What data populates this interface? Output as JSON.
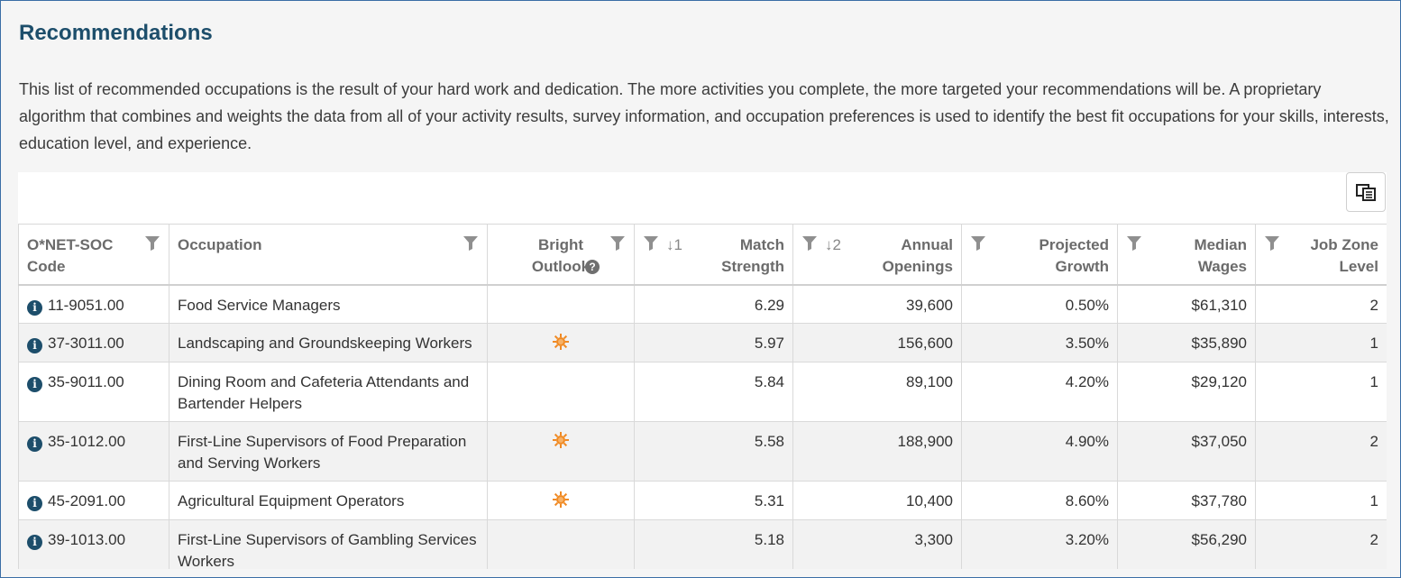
{
  "page": {
    "title": "Recommendations",
    "intro": "This list of recommended occupations is the result of your hard work and dedication. The more activities you complete, the more targeted your recommendations will be. A proprietary algorithm that combines and weights the data from all of your activity results, survey information, and occupation preferences is used to identify the best fit occupations for your skills, interests, education level, and experience."
  },
  "toolbar": {
    "column_chooser_icon": "column-chooser-icon"
  },
  "table": {
    "headers": {
      "code": "O*NET-SOC Code",
      "occupation": "Occupation",
      "bright_outlook": "Bright Outlook",
      "match_strength": "Match Strength",
      "annual_openings": "Annual Openings",
      "projected_growth": "Projected Growth",
      "median_wages": "Median Wages",
      "job_zone": "Job Zone Level"
    },
    "sort_indicators": {
      "match_strength": "↓1",
      "annual_openings": "↓2"
    },
    "icons": {
      "filter": "filter-icon",
      "info": "info-icon",
      "help": "help-icon",
      "bright_outlook": "sun-icon"
    },
    "colors": {
      "title": "#1d4e6b",
      "info_icon": "#1d4e6b",
      "sun": "#f08a24"
    },
    "rows": [
      {
        "code": "11-9051.00",
        "occupation": "Food Service Managers",
        "bright": false,
        "match": "6.29",
        "openings": "39,600",
        "growth": "0.50%",
        "wages": "$61,310",
        "zone": "2"
      },
      {
        "code": "37-3011.00",
        "occupation": "Landscaping and Groundskeeping Workers",
        "bright": true,
        "match": "5.97",
        "openings": "156,600",
        "growth": "3.50%",
        "wages": "$35,890",
        "zone": "1"
      },
      {
        "code": "35-9011.00",
        "occupation": "Dining Room and Cafeteria Attendants and Bartender Helpers",
        "bright": false,
        "match": "5.84",
        "openings": "89,100",
        "growth": "4.20%",
        "wages": "$29,120",
        "zone": "1"
      },
      {
        "code": "35-1012.00",
        "occupation": "First-Line Supervisors of Food Preparation and Serving Workers",
        "bright": true,
        "match": "5.58",
        "openings": "188,900",
        "growth": "4.90%",
        "wages": "$37,050",
        "zone": "2"
      },
      {
        "code": "45-2091.00",
        "occupation": "Agricultural Equipment Operators",
        "bright": true,
        "match": "5.31",
        "openings": "10,400",
        "growth": "8.60%",
        "wages": "$37,780",
        "zone": "1"
      },
      {
        "code": "39-1013.00",
        "occupation": "First-Line Supervisors of Gambling Services Workers",
        "bright": false,
        "match": "5.18",
        "openings": "3,300",
        "growth": "3.20%",
        "wages": "$56,290",
        "zone": "2"
      }
    ]
  }
}
